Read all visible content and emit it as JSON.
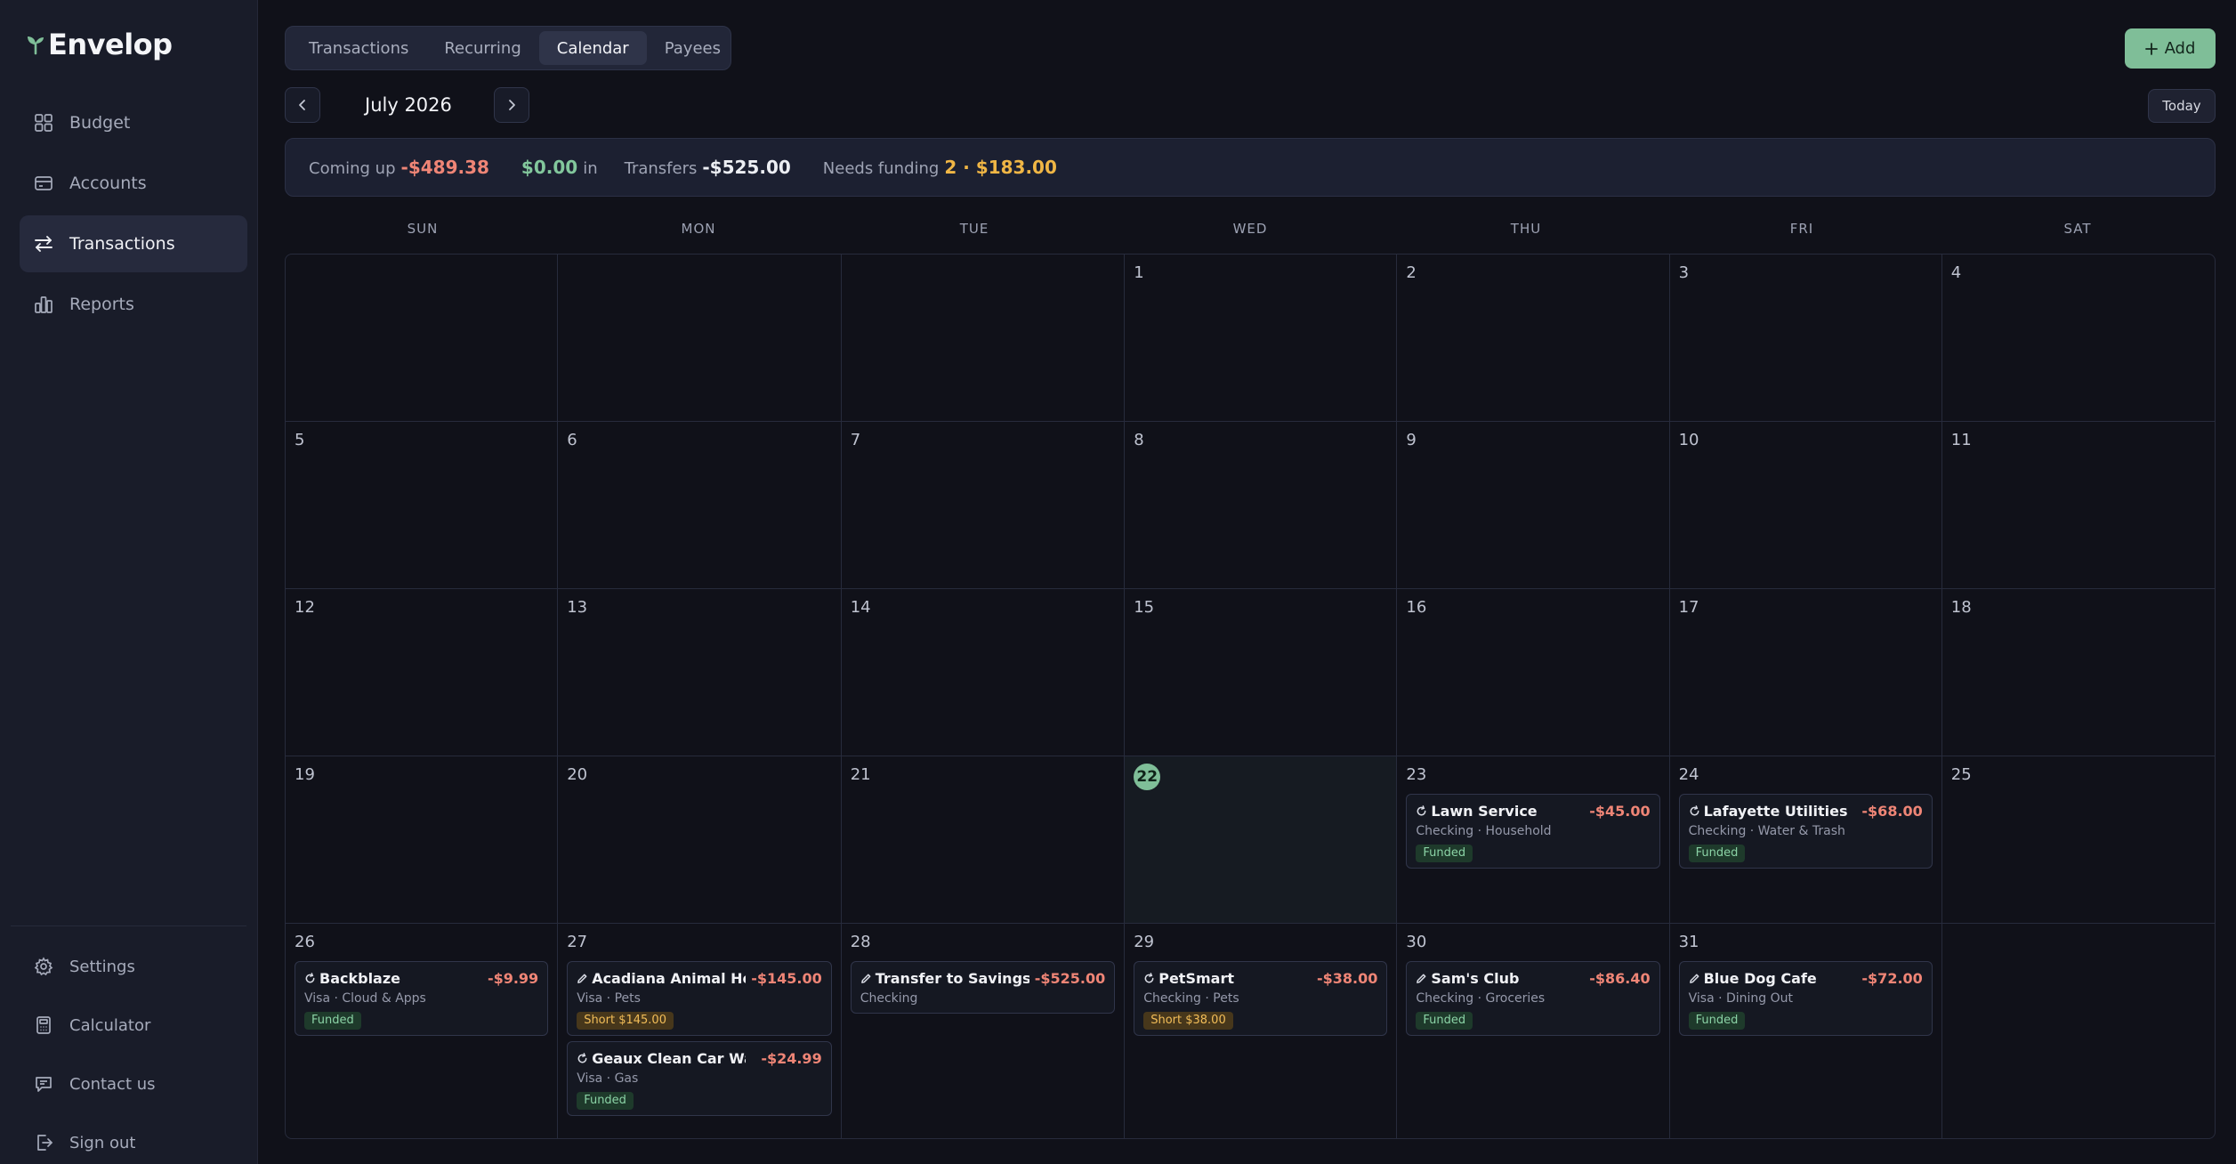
{
  "app": {
    "name": "Envelop",
    "brand_color": "#7fbe98"
  },
  "sidebar": {
    "items": [
      {
        "label": "Budget",
        "icon": "grid-icon",
        "active": false
      },
      {
        "label": "Accounts",
        "icon": "wallet-icon",
        "active": false
      },
      {
        "label": "Transactions",
        "icon": "arrows-icon",
        "active": true
      },
      {
        "label": "Reports",
        "icon": "bar-chart-icon",
        "active": false
      }
    ],
    "bottom_items": [
      {
        "label": "Settings",
        "icon": "gear-icon"
      },
      {
        "label": "Calculator",
        "icon": "calculator-icon"
      },
      {
        "label": "Contact us",
        "icon": "message-icon"
      },
      {
        "label": "Sign out",
        "icon": "sign-out-icon"
      }
    ]
  },
  "tabs": [
    {
      "label": "Transactions",
      "active": false
    },
    {
      "label": "Recurring",
      "active": false
    },
    {
      "label": "Calendar",
      "active": true
    },
    {
      "label": "Payees",
      "active": false
    }
  ],
  "header": {
    "add_label": "Add",
    "month": "July 2026",
    "today_label": "Today"
  },
  "summary": {
    "coming_up_label": "Coming up",
    "coming_up_value": "-$489.38",
    "in_value": "$0.00",
    "in_label": "in",
    "transfers_label": "Transfers",
    "transfers_value": "-$525.00",
    "needs_funding_label": "Needs funding",
    "needs_funding_value": "2 · $183.00"
  },
  "calendar": {
    "weekdays": [
      "SUN",
      "MON",
      "TUE",
      "WED",
      "THU",
      "FRI",
      "SAT"
    ],
    "today": 22,
    "first_weekday": 3,
    "days_in_month": 31,
    "transactions": [
      {
        "day": 23,
        "name": "Lawn Service",
        "amount": "-$45.00",
        "sub": "Checking · Household",
        "status": "Funded",
        "status_type": "funded",
        "kind": "recurring"
      },
      {
        "day": 24,
        "name": "Lafayette Utilities",
        "amount": "-$68.00",
        "sub": "Checking · Water & Trash",
        "status": "Funded",
        "status_type": "funded",
        "kind": "recurring"
      },
      {
        "day": 26,
        "name": "Backblaze",
        "amount": "-$9.99",
        "sub": "Visa · Cloud & Apps",
        "status": "Funded",
        "status_type": "funded",
        "kind": "recurring"
      },
      {
        "day": 27,
        "name": "Acadiana Animal Ho...",
        "amount": "-$145.00",
        "sub": "Visa · Pets",
        "status": "Short $145.00",
        "status_type": "short",
        "kind": "manual"
      },
      {
        "day": 27,
        "name": "Geaux Clean Car Wash",
        "amount": "-$24.99",
        "sub": "Visa · Gas",
        "status": "Funded",
        "status_type": "funded",
        "kind": "recurring"
      },
      {
        "day": 28,
        "name": "Transfer to Savings",
        "amount": "-$525.00",
        "sub": "Checking",
        "status": "",
        "status_type": "",
        "kind": "manual"
      },
      {
        "day": 29,
        "name": "PetSmart",
        "amount": "-$38.00",
        "sub": "Checking · Pets",
        "status": "Short $38.00",
        "status_type": "short",
        "kind": "recurring"
      },
      {
        "day": 30,
        "name": "Sam's Club",
        "amount": "-$86.40",
        "sub": "Checking · Groceries",
        "status": "Funded",
        "status_type": "funded",
        "kind": "manual"
      },
      {
        "day": 31,
        "name": "Blue Dog Cafe",
        "amount": "-$72.00",
        "sub": "Visa · Dining Out",
        "status": "Funded",
        "status_type": "funded",
        "kind": "manual"
      }
    ]
  }
}
